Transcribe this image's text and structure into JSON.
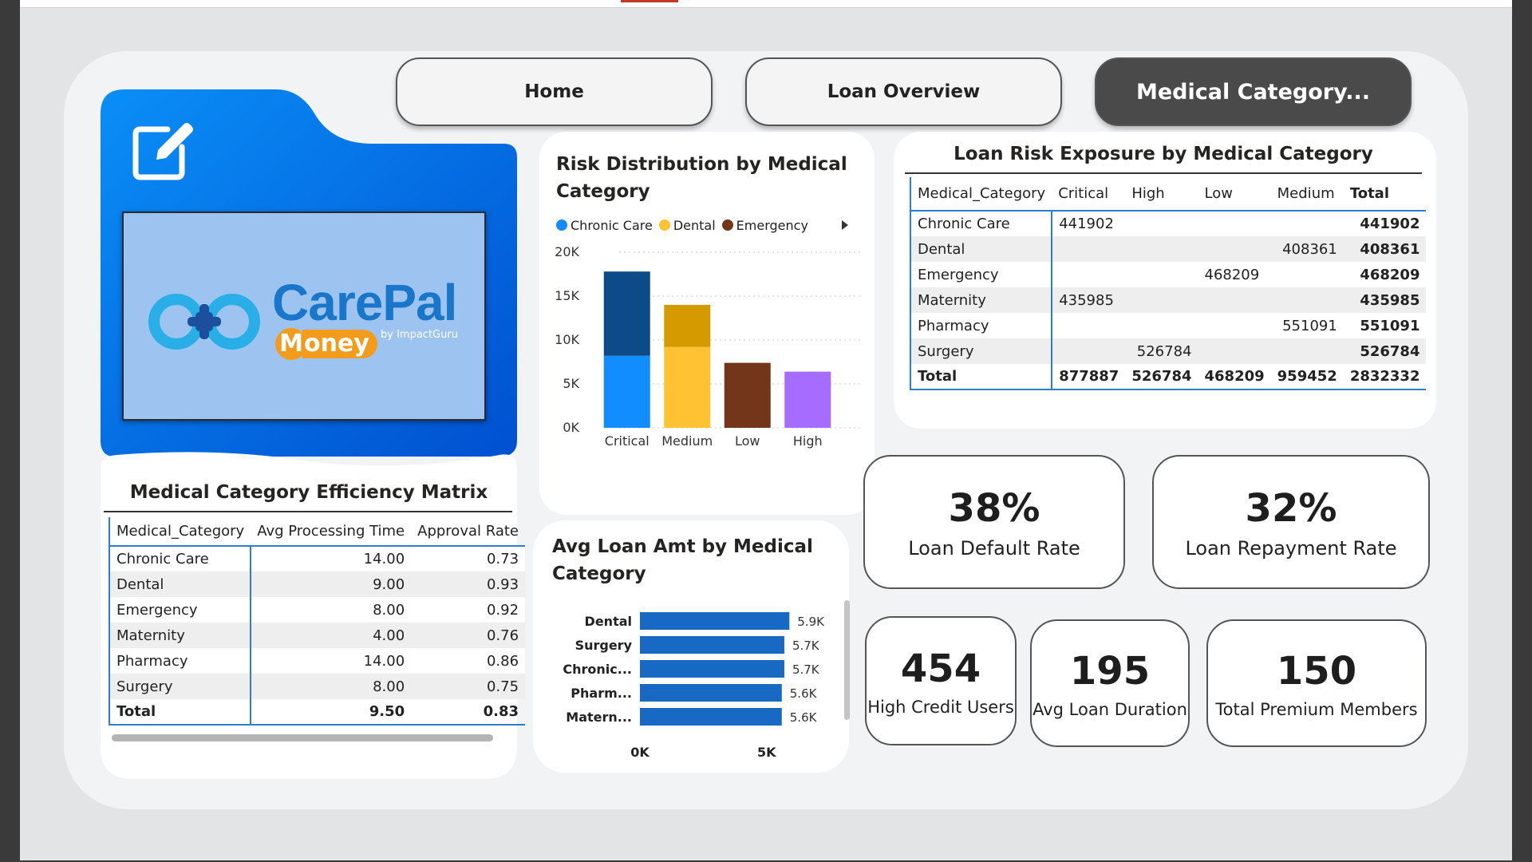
{
  "nav": {
    "home": "Home",
    "loan_overview": "Loan Overview",
    "medical_category": "Medical Category..."
  },
  "logo": {
    "brand_care": "Care",
    "brand_pal": "Pal",
    "by_line": "by ImpactGuru",
    "money_m": "M",
    "money_rest": "oney",
    "edit_icon": "edit-icon"
  },
  "efficiency": {
    "title": "Medical Category Efficiency Matrix",
    "headers": [
      "Medical_Category",
      "Avg Processing Time",
      "Approval Rate"
    ],
    "rows": [
      [
        "Chronic Care",
        "14.00",
        "0.73"
      ],
      [
        "Dental",
        "9.00",
        "0.93"
      ],
      [
        "Emergency",
        "8.00",
        "0.92"
      ],
      [
        "Maternity",
        "4.00",
        "0.76"
      ],
      [
        "Pharmacy",
        "14.00",
        "0.86"
      ],
      [
        "Surgery",
        "8.00",
        "0.75"
      ]
    ],
    "total": [
      "Total",
      "9.50",
      "0.83"
    ]
  },
  "risk_chart": {
    "title": "Risk Distribution by Medical Category",
    "legend": [
      {
        "name": "Chronic Care",
        "color": "#118dff"
      },
      {
        "name": "Dental",
        "color": "#ffc233"
      },
      {
        "name": "Emergency",
        "color": "#74361b"
      }
    ]
  },
  "exposure": {
    "title": "Loan Risk Exposure by Medical Category",
    "headers": [
      "Medical_Category",
      "Critical",
      "High",
      "Low",
      "Medium",
      "Total"
    ],
    "rows": [
      [
        "Chronic Care",
        "441902",
        "",
        "",
        "",
        "441902"
      ],
      [
        "Dental",
        "",
        "",
        "",
        "408361",
        "408361"
      ],
      [
        "Emergency",
        "",
        "",
        "468209",
        "",
        "468209"
      ],
      [
        "Maternity",
        "435985",
        "",
        "",
        "",
        "435985"
      ],
      [
        "Pharmacy",
        "",
        "",
        "",
        "551091",
        "551091"
      ],
      [
        "Surgery",
        "",
        "526784",
        "",
        "",
        "526784"
      ]
    ],
    "total": [
      "Total",
      "877887",
      "526784",
      "468209",
      "959452",
      "2832332"
    ]
  },
  "avg_chart": {
    "title": "Avg Loan Amt by Medical Category"
  },
  "kpis": {
    "default_rate": {
      "value": "38%",
      "label": "Loan Default Rate"
    },
    "repayment_rate": {
      "value": "32%",
      "label": "Loan Repayment Rate"
    },
    "high_credit": {
      "value": "454",
      "label": "High Credit Users"
    },
    "avg_duration": {
      "value": "195",
      "label": "Avg Loan Duration"
    },
    "premium": {
      "value": "150",
      "label": "Total Premium Members"
    }
  },
  "chart_data": [
    {
      "type": "bar",
      "stacked": true,
      "title": "Risk Distribution by Medical Category",
      "categories": [
        "Critical",
        "Medium",
        "Low",
        "High"
      ],
      "series": [
        {
          "name": "Chronic Care",
          "color": "#118dff",
          "values": [
            8200,
            0,
            0,
            0
          ]
        },
        {
          "name": "Dental",
          "color": "#ffc233",
          "values": [
            0,
            9200,
            0,
            0
          ]
        },
        {
          "name": "Emergency",
          "color": "#74361b",
          "values": [
            0,
            0,
            7400,
            0
          ]
        },
        {
          "name": "",
          "color": "#0d4a8a",
          "values": [
            9600,
            0,
            0,
            0
          ]
        },
        {
          "name": "",
          "color": "#d49a00",
          "values": [
            0,
            4800,
            0,
            0
          ]
        },
        {
          "name": "",
          "color": "#a66bff",
          "values": [
            0,
            0,
            0,
            6400
          ]
        }
      ],
      "yticks": [
        "0K",
        "5K",
        "10K",
        "15K",
        "20K"
      ],
      "ylim": [
        0,
        20000
      ],
      "grid": true,
      "legend_position": "top-left"
    },
    {
      "type": "bar",
      "orientation": "horizontal",
      "title": "Avg Loan Amt by Medical Category",
      "categories": [
        "Dental",
        "Surgery",
        "Chronic...",
        "Pharm...",
        "Matern..."
      ],
      "values": [
        5900,
        5700,
        5700,
        5600,
        5600
      ],
      "labels": [
        "5.9K",
        "5.7K",
        "5.7K",
        "5.6K",
        "5.6K"
      ],
      "color": "#1769c4",
      "xticks": [
        "0K",
        "5K"
      ],
      "xlim": [
        0,
        6300
      ]
    }
  ]
}
